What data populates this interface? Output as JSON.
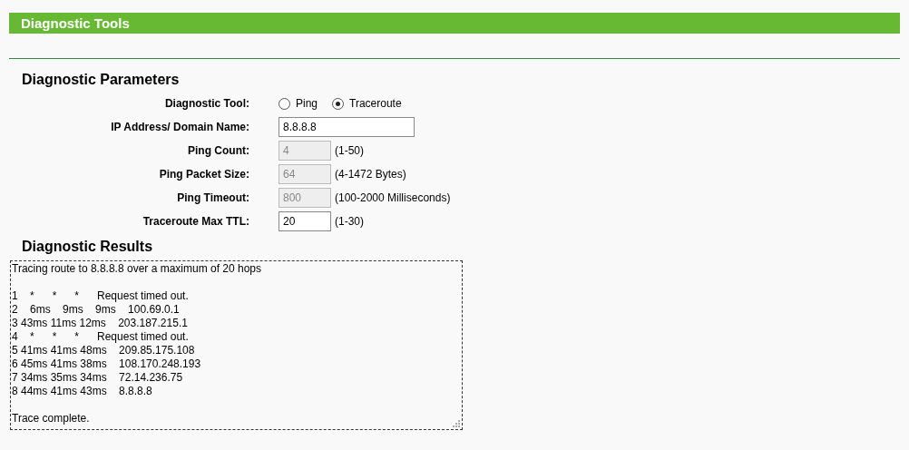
{
  "header": {
    "title": "Diagnostic Tools"
  },
  "parameters": {
    "title": "Diagnostic Parameters",
    "rows": [
      {
        "kind": "radio",
        "label": "Diagnostic Tool:",
        "options": [
          {
            "label": "Ping",
            "selected": false
          },
          {
            "label": "Traceroute",
            "selected": true
          }
        ]
      },
      {
        "kind": "text",
        "label": "IP Address/ Domain Name:",
        "value": "8.8.8.8",
        "disabled": false
      },
      {
        "kind": "text",
        "label": "Ping Count:",
        "value": "4",
        "disabled": true,
        "hint": "(1-50)"
      },
      {
        "kind": "text",
        "label": "Ping Packet Size:",
        "value": "64",
        "disabled": true,
        "hint": "(4-1472 Bytes)"
      },
      {
        "kind": "text",
        "label": "Ping Timeout:",
        "value": "800",
        "disabled": true,
        "hint": "(100-2000 Milliseconds)"
      },
      {
        "kind": "text",
        "label": "Traceroute Max TTL:",
        "value": "20",
        "disabled": false,
        "hint": "(1-30)"
      }
    ]
  },
  "results": {
    "title": "Diagnostic Results",
    "intro": "Tracing route to 8.8.8.8 over a maximum of 20 hops",
    "hops": [
      "1    *      *      *      Request timed out.",
      "2    6ms    9ms    9ms    100.69.0.1",
      "3 43ms 11ms 12ms    203.187.215.1",
      "4    *      *      *      Request timed out.",
      "5 41ms 41ms 48ms    209.85.175.108",
      "6 45ms 41ms 38ms    108.170.248.193",
      "7 34ms 35ms 34ms    72.14.236.75",
      "8 44ms 41ms 43ms    8.8.8.8"
    ],
    "footer": "Trace complete."
  }
}
